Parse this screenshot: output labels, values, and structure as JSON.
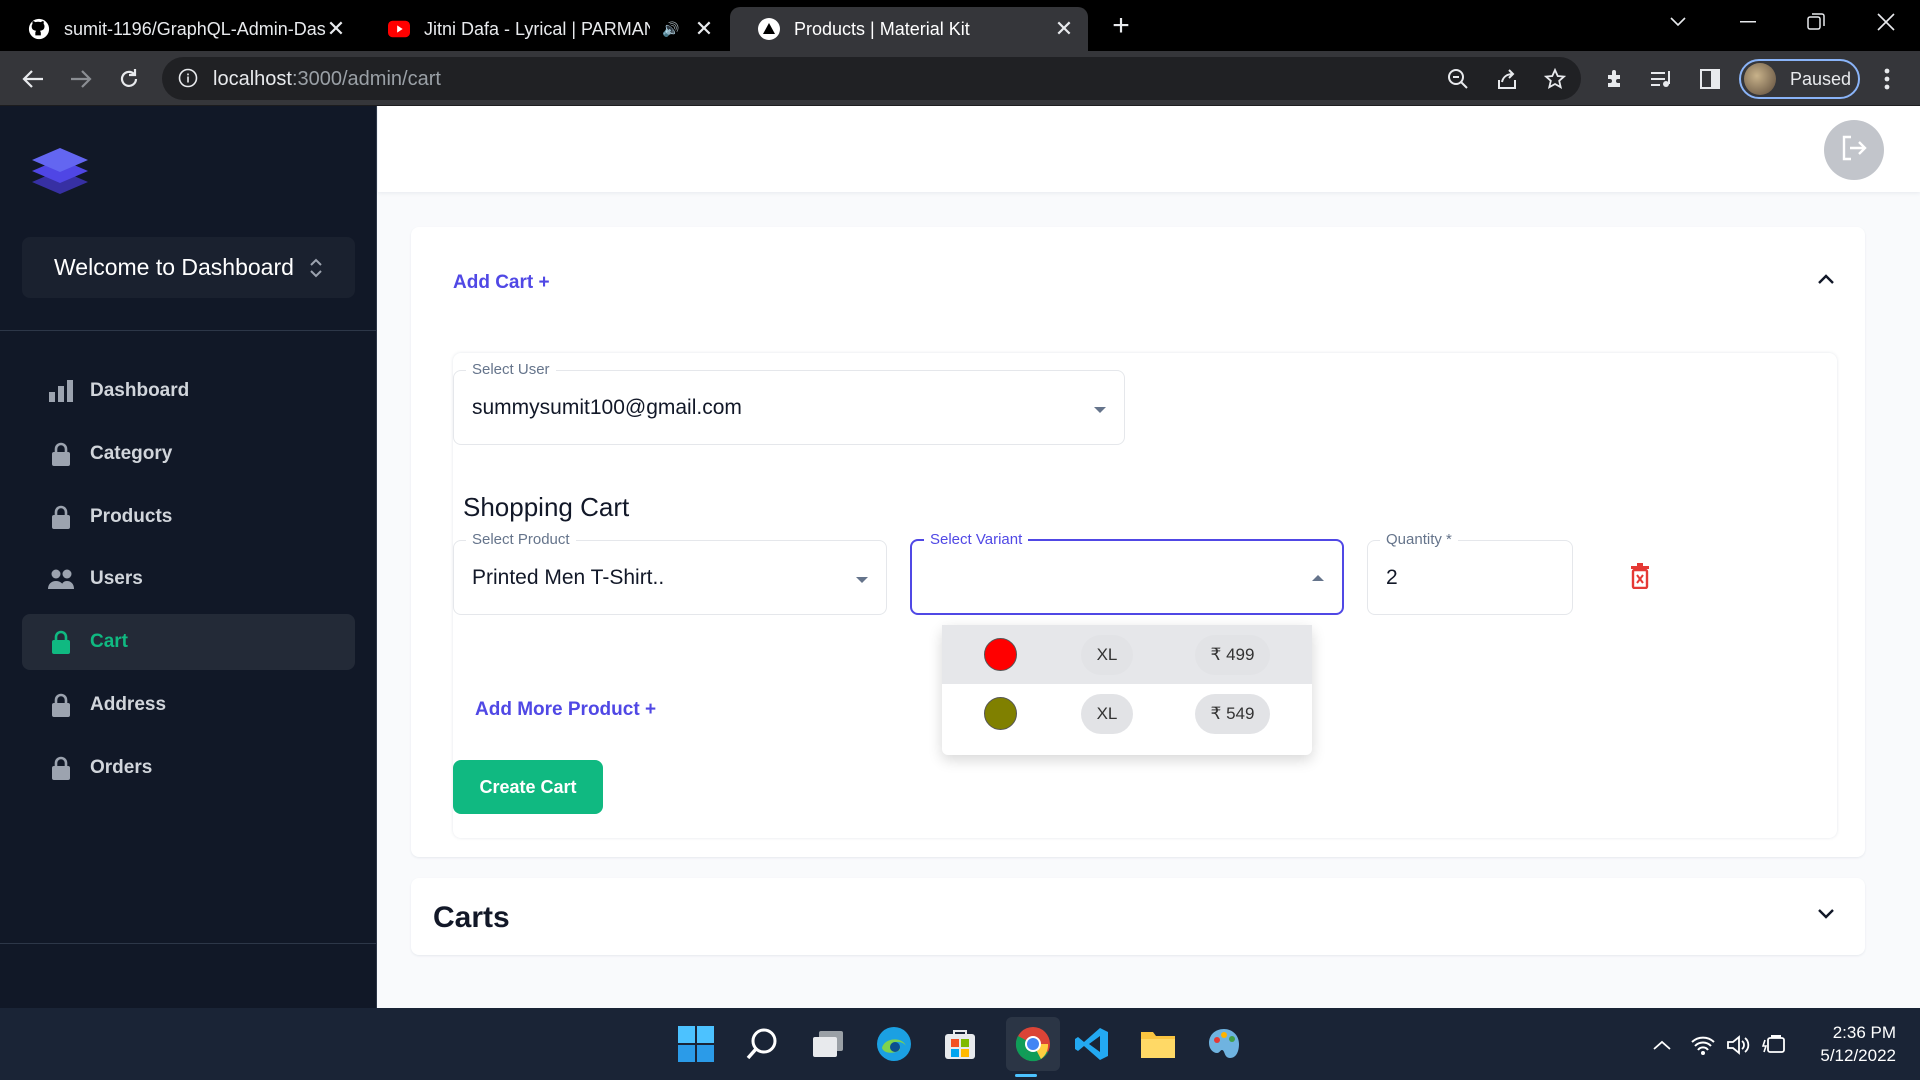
{
  "browser": {
    "tabs": [
      {
        "title": "sumit-1196/GraphQL-Admin-Dashboard",
        "icon": "github-icon"
      },
      {
        "title": "Jitni Dafa - Lyrical | PARMANU",
        "icon": "youtube-icon",
        "audio": true
      },
      {
        "title": "Products | Material Kit",
        "icon": "material-kit-icon",
        "active": true
      }
    ],
    "url_host": "localhost",
    "url_path": ":3000/admin/cart",
    "profile_label": "Paused"
  },
  "sidebar": {
    "welcome": "Welcome to Dashboard",
    "items": [
      {
        "label": "Dashboard",
        "icon": "chart-bar-icon"
      },
      {
        "label": "Category",
        "icon": "lock-icon"
      },
      {
        "label": "Products",
        "icon": "lock-icon"
      },
      {
        "label": "Users",
        "icon": "users-icon"
      },
      {
        "label": "Cart",
        "icon": "lock-icon",
        "active": true
      },
      {
        "label": "Address",
        "icon": "lock-icon"
      },
      {
        "label": "Orders",
        "icon": "lock-icon"
      }
    ]
  },
  "cart_form": {
    "add_cart_label": "Add Cart +",
    "user": {
      "label": "Select User",
      "value": "summysumit100@gmail.com"
    },
    "shopping_cart_title": "Shopping Cart",
    "product": {
      "label": "Select Product",
      "value": "Printed Men T-Shirt.."
    },
    "variant": {
      "label": "Select Variant",
      "value": ""
    },
    "quantity": {
      "label": "Quantity *",
      "value": "2"
    },
    "add_more_label": "Add More Product +",
    "create_label": "Create Cart",
    "variant_options": [
      {
        "color": "#ff0000",
        "size": "XL",
        "price": "₹ 499",
        "highlighted": true
      },
      {
        "color": "#808000",
        "size": "XL",
        "price": "₹ 549",
        "highlighted": false
      }
    ]
  },
  "carts_section": {
    "title": "Carts"
  },
  "taskbar": {
    "time": "2:36 PM",
    "date": "5/12/2022"
  }
}
